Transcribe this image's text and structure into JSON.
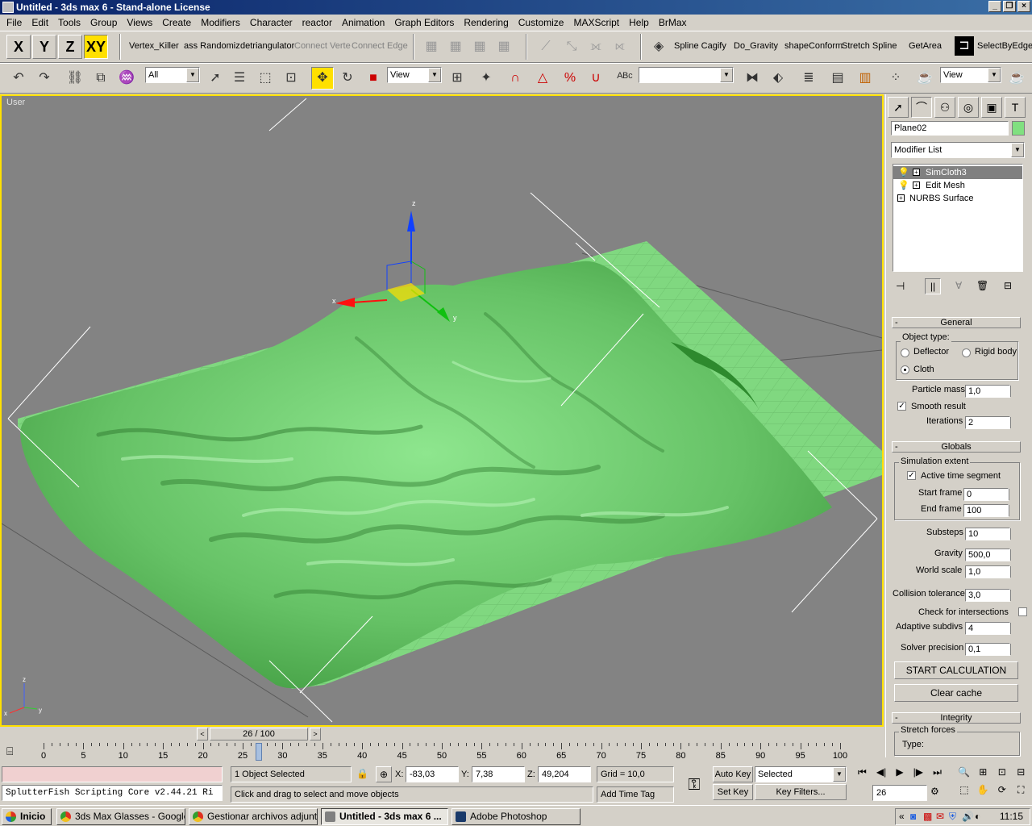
{
  "window": {
    "title": "Untitled - 3ds max 6 - Stand-alone License"
  },
  "menu": [
    "File",
    "Edit",
    "Tools",
    "Group",
    "Views",
    "Create",
    "Modifiers",
    "Character",
    "reactor",
    "Animation",
    "Graph Editors",
    "Rendering",
    "Customize",
    "MAXScript",
    "Help",
    "BrMax"
  ],
  "toolbar1": {
    "axes": [
      "X",
      "Y",
      "Z",
      "XY"
    ],
    "scripts": [
      "Vertex_Killer",
      "ass Randomiz",
      "detriangulator",
      "Connect Verte",
      "Connect Edge"
    ],
    "scripts2": [
      "Spline Cagify",
      "Do_Gravity",
      "shapeConform",
      "Stretch Spline",
      "GetArea",
      "SelectByEdge"
    ]
  },
  "toolbar2": {
    "selection_filter": "All",
    "ref_coord": "View",
    "named_selection": "",
    "ref_coord2": "View"
  },
  "viewport": {
    "label": "User",
    "axis_labels": {
      "x": "x",
      "y": "y",
      "z": "z"
    }
  },
  "command_panel": {
    "object_name": "Plane02",
    "object_color": "#80e080",
    "modifier_list": "Modifier List",
    "stack": [
      "SimCloth3",
      "Edit Mesh",
      "NURBS Surface"
    ],
    "general": {
      "title": "General",
      "object_type_label": "Object type:",
      "deflector": "Deflector",
      "rigid_body": "Rigid body",
      "cloth": "Cloth",
      "particle_mass_label": "Particle mass",
      "particle_mass": "1,0",
      "smooth_result": "Smooth result",
      "iterations_label": "Iterations",
      "iterations": "2"
    },
    "globals": {
      "title": "Globals",
      "simulation_extent": "Simulation extent",
      "active_time_segment": "Active time segment",
      "start_frame_label": "Start frame",
      "start_frame": "0",
      "end_frame_label": "End frame",
      "end_frame": "100",
      "substeps_label": "Substeps",
      "substeps": "10",
      "gravity_label": "Gravity",
      "gravity": "500,0",
      "world_scale_label": "World scale",
      "world_scale": "1,0",
      "collision_tolerance_label": "Collision tolerance",
      "collision_tolerance": "3,0",
      "check_intersections": "Check for intersections",
      "adaptive_subdivs_label": "Adaptive subdivs",
      "adaptive_subdivs": "4",
      "solver_precision_label": "Solver precision",
      "solver_precision": "0,1",
      "start_calculation": "START CALCULATION",
      "clear_cache": "Clear cache"
    },
    "integrity": {
      "title": "Integrity",
      "stretch_forces": "Stretch forces",
      "type_label": "Type:"
    }
  },
  "timeline": {
    "slider_label": "26 / 100",
    "current_frame": 26,
    "total_frames": 100,
    "ticks": [
      "0",
      "5",
      "10",
      "15",
      "20",
      "25",
      "30",
      "35",
      "40",
      "45",
      "50",
      "55",
      "60",
      "65",
      "70",
      "75",
      "80",
      "85",
      "90",
      "95",
      "100"
    ]
  },
  "status": {
    "script_core": "SplutterFish Scripting Core v2.44.21 Ri",
    "selection": "1 Object Selected",
    "prompt": "Click and drag to select and move objects",
    "x_label": "X:",
    "x": "-83,03",
    "y_label": "Y:",
    "y": "7,38",
    "z_label": "Z:",
    "z": "49,204",
    "grid": "Grid = 10,0",
    "add_time_tag": "Add Time Tag",
    "auto_key": "Auto Key",
    "set_key": "Set Key",
    "key_mode": "Selected",
    "key_filters": "Key Filters...",
    "frame_field": "26"
  },
  "taskbar": {
    "start": "Inicio",
    "tasks": [
      "3ds Max Glasses - Google...",
      "Gestionar archivos adjunt...",
      "Untitled - 3ds max 6 ...",
      "Adobe Photoshop"
    ],
    "clock": "11:15"
  }
}
